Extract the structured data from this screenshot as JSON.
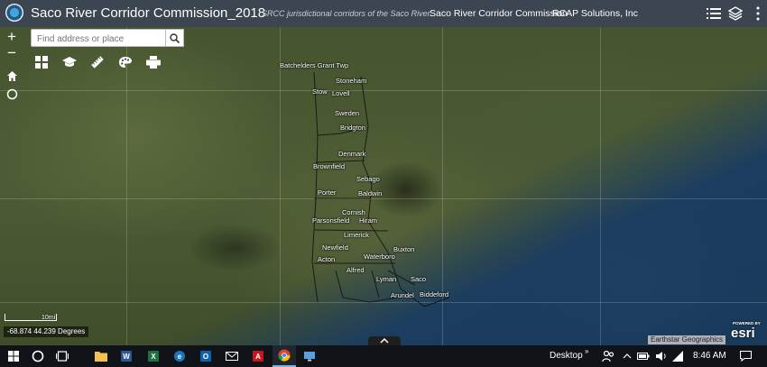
{
  "header": {
    "title": "Saco River Corridor Commission_2018",
    "subtitle": "SRCC jurisdictional corridors of the Saco River.",
    "links": [
      "Saco River Corridor Commission",
      "RCAP Solutions, Inc"
    ],
    "icons": [
      "list-icon",
      "layers-icon"
    ]
  },
  "search": {
    "placeholder": "Find address or place",
    "value": ""
  },
  "zoom": {
    "in_label": "+",
    "out_label": "−"
  },
  "toolbar": {
    "tools": [
      "basemap-gallery-icon",
      "graduation-cap-icon",
      "measure-ruler-icon",
      "palette-icon",
      "print-icon"
    ]
  },
  "map": {
    "towns": [
      {
        "name": "Batchelders Grant Twp"
      },
      {
        "name": "Stoneham"
      },
      {
        "name": "Stow"
      },
      {
        "name": "Lovell"
      },
      {
        "name": "Sweden"
      },
      {
        "name": "Bridgton"
      },
      {
        "name": "Denmark"
      },
      {
        "name": "Brownfield"
      },
      {
        "name": "Sebago"
      },
      {
        "name": "Baldwin"
      },
      {
        "name": "Porter"
      },
      {
        "name": "Cornish"
      },
      {
        "name": "Parsonsfield"
      },
      {
        "name": "Hiram"
      },
      {
        "name": "Limerick"
      },
      {
        "name": "Newfield"
      },
      {
        "name": "Waterboro"
      },
      {
        "name": "Buxton"
      },
      {
        "name": "Acton"
      },
      {
        "name": "Alfred"
      },
      {
        "name": "Lyman"
      },
      {
        "name": "Saco"
      },
      {
        "name": "Arundel"
      },
      {
        "name": "Biddeford"
      }
    ],
    "scale_label": "10mi",
    "coordinates": "-68.874 44.239 Degrees",
    "attribution": "Earthstar Geographics",
    "esri_powered": "POWERED BY",
    "esri_logo": "esri"
  },
  "taskbar": {
    "desktop_label": "Desktop",
    "time": "8:46 AM",
    "apps": [
      "file-explorer",
      "word",
      "excel",
      "edge",
      "outlook",
      "mail",
      "acrobat",
      "chrome",
      "remote-desktop"
    ]
  },
  "colors": {
    "title_bar": "#3c4650",
    "taskbar": "#101418",
    "accent": "#7ab3e8"
  }
}
